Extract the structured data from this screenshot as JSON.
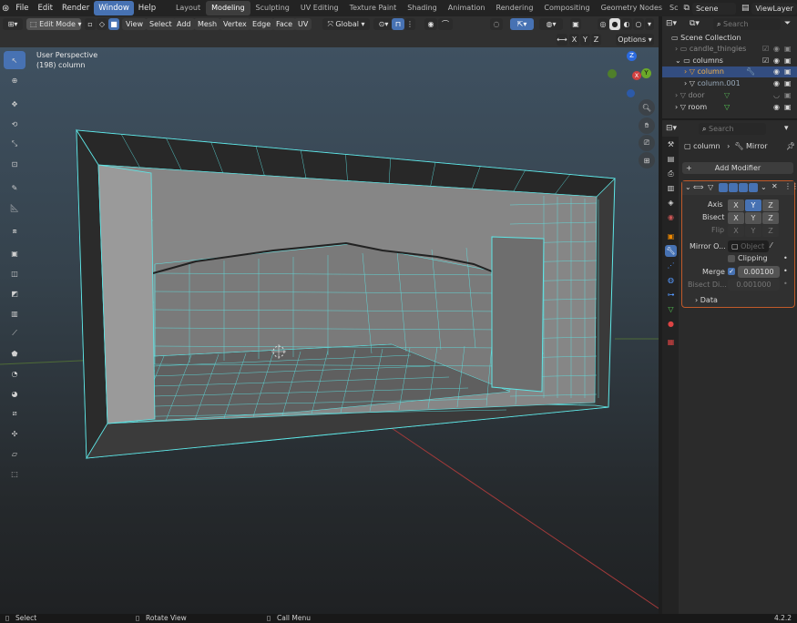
{
  "menubar": {
    "items": [
      "File",
      "Edit",
      "Render",
      "Window",
      "Help"
    ],
    "active": "Window",
    "workspaces": [
      "Layout",
      "Modeling",
      "Sculpting",
      "UV Editing",
      "Texture Paint",
      "Shading",
      "Animation",
      "Rendering",
      "Compositing",
      "Geometry Nodes",
      "Sc"
    ],
    "active_workspace": "Modeling",
    "scene": "Scene",
    "view_layer": "ViewLayer"
  },
  "viewport_header": {
    "mode": "Edit Mode",
    "menus": [
      "View",
      "Select",
      "Add",
      "Mesh",
      "Vertex",
      "Edge",
      "Face",
      "UV"
    ],
    "orientation": "Global",
    "options_label": "Options",
    "axes": [
      "X",
      "Y",
      "Z"
    ]
  },
  "viewport": {
    "perspective_label": "User Perspective",
    "object_label": "(198) column"
  },
  "nav_gizmo": {
    "x": "X",
    "y": "Y",
    "z": "Z"
  },
  "outliner": {
    "search_placeholder": "Search",
    "root": "Scene Collection",
    "rows": [
      {
        "label": "candle_thingies",
        "muted": true
      },
      {
        "label": "columns",
        "muted": false
      },
      {
        "label": "column",
        "muted": false,
        "selected": true
      },
      {
        "label": "column.001",
        "muted": false
      },
      {
        "label": "door",
        "muted": true
      },
      {
        "label": "room",
        "muted": false
      }
    ]
  },
  "properties": {
    "search_placeholder": "Search",
    "object_name": "column",
    "modifier_breadcrumb": "Mirror",
    "add_modifier_label": "Add Modifier",
    "axis_label": "Axis",
    "bisect_label": "Bisect",
    "flip_label": "Flip",
    "xyz": [
      "X",
      "Y",
      "Z"
    ],
    "mirror_object_label": "Mirror O...",
    "object_placeholder": "Object",
    "clipping_label": "Clipping",
    "merge_label": "Merge",
    "merge_value": "0.00100",
    "bisect_distance_label": "Bisect Di...",
    "bisect_distance_value": "0.001000",
    "data_label": "Data"
  },
  "statusbar": {
    "select": "Select",
    "rotate": "Rotate View",
    "call_menu": "Call Menu",
    "version": "4.2.2"
  },
  "colors": {
    "accent": "#4772b3",
    "wire_selected": "#5ee6e6",
    "panel": "#2b2b2b"
  }
}
